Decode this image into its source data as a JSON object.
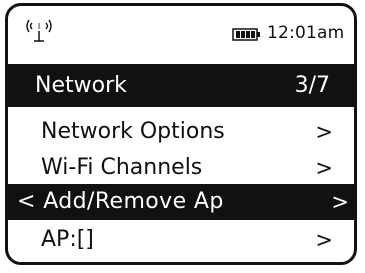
{
  "status": {
    "time": "12:01am",
    "signal_icon": "wifi-signal-icon",
    "battery_icon": "battery-icon"
  },
  "header": {
    "title": "Network",
    "page": "3/7"
  },
  "menu": {
    "items": [
      {
        "label": "Network Options",
        "arrow": ">"
      },
      {
        "label": "Wi-Fi Channels",
        "arrow": ">"
      },
      {
        "label": "< Add/Remove Ap",
        "arrow": ">",
        "selected": true
      },
      {
        "label": "AP:[]",
        "arrow": ">"
      }
    ]
  },
  "colors": {
    "foreground": "#111111",
    "background": "#ffffff",
    "highlight": "#111111"
  }
}
